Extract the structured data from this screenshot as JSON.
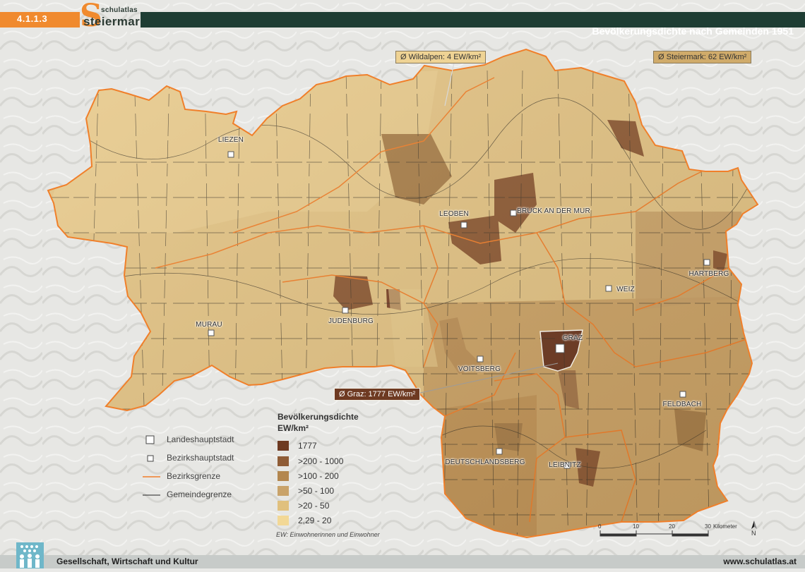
{
  "header": {
    "section_number": "4.1.1.3",
    "logo_small": "schulatlas",
    "logo_big": "steiermark",
    "logo_letter": "S",
    "title": "Bevölkerungsdichte nach Gemeinden 1951"
  },
  "footer": {
    "subject": "Gesellschaft, Wirtschaft und Kultur",
    "url": "www.schulatlas.at"
  },
  "callouts": {
    "wildalpen": "Ø Wildalpen: 4 EW/km²",
    "steiermark": "Ø Steiermark: 62 EW/km²",
    "graz": "Ø Graz: 1777 EW/km²"
  },
  "cities": [
    {
      "name": "LIEZEN",
      "type": "Bezirkshauptstadt"
    },
    {
      "name": "LEOBEN",
      "type": "Bezirkshauptstadt"
    },
    {
      "name": "BRUCK AN DER MUR",
      "type": "Bezirkshauptstadt"
    },
    {
      "name": "HARTBERG",
      "type": "Bezirkshauptstadt"
    },
    {
      "name": "WEIZ",
      "type": "Bezirkshauptstadt"
    },
    {
      "name": "JUDENBURG",
      "type": "Bezirkshauptstadt"
    },
    {
      "name": "MURAU",
      "type": "Bezirkshauptstadt"
    },
    {
      "name": "GRAZ",
      "type": "Landeshauptstadt"
    },
    {
      "name": "VOITSBERG",
      "type": "Bezirkshauptstadt"
    },
    {
      "name": "FELDBACH",
      "type": "Bezirkshauptstadt"
    },
    {
      "name": "DEUTSCHLANDSBERG",
      "type": "Bezirkshauptstadt"
    },
    {
      "name": "LEIBNITZ",
      "type": "Bezirkshauptstadt"
    }
  ],
  "legend": {
    "title_line1": "Bevölkerungsdichte",
    "title_line2": "EW/km²",
    "classes": [
      {
        "label": "1777",
        "color": "#6e3a22"
      },
      {
        "label": ">200 - 1000",
        "color": "#8f5c36"
      },
      {
        "label": ">100 - 200",
        "color": "#b3874f"
      },
      {
        "label": ">50 - 100",
        "color": "#c9a36a"
      },
      {
        "label": ">20 - 50",
        "color": "#e0c07d"
      },
      {
        "label": "2,29 - 20",
        "color": "#f2d896"
      }
    ],
    "note": "EW: Einwohnerinnen und Einwohner"
  },
  "symbols": {
    "landeshauptstadt": "Landeshauptstadt",
    "bezirkshauptstadt": "Bezirkshauptstadt",
    "bezirksgrenze": "Bezirksgrenze",
    "gemeindegrenze": "Gemeindegrenze"
  },
  "scalebar": {
    "ticks": [
      "0",
      "10",
      "20",
      "30"
    ],
    "unit": "Kilometer"
  },
  "north_label": "N",
  "colors": {
    "accent_orange": "#f08a2e",
    "header_green": "#1e3d33",
    "district_border": "#f07f2a"
  }
}
